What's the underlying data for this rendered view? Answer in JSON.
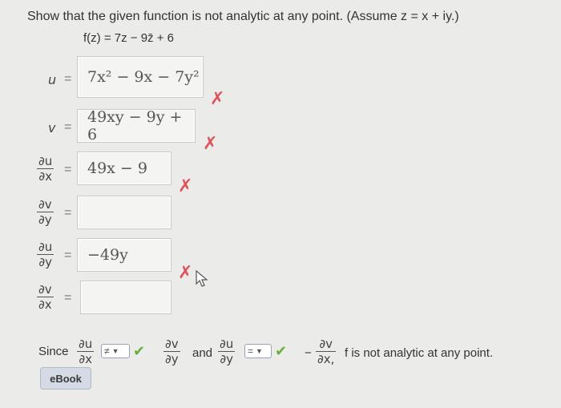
{
  "question": {
    "prompt": "Show that the given function is not analytic at any point. (Assume z = x + iy.)",
    "function": "f(z) = 7z − 9z̄ + 6"
  },
  "rows": [
    {
      "label": "u",
      "answer": "7x² − 9x − 7y²",
      "status": "incorrect"
    },
    {
      "label": "v",
      "answer": "49xy − 9y + 6",
      "status": "incorrect"
    },
    {
      "num": "∂u",
      "den": "∂x",
      "answer": "49x − 9",
      "status": "incorrect"
    },
    {
      "num": "∂v",
      "den": "∂y",
      "answer": "",
      "status": ""
    },
    {
      "num": "∂u",
      "den": "∂y",
      "answer": "−49y",
      "status": "incorrect"
    },
    {
      "num": "∂v",
      "den": "∂x",
      "answer": "",
      "status": ""
    }
  ],
  "conclusion": {
    "since": "Since",
    "d1_num": "∂u",
    "d1_den": "∂x",
    "select1": "≠",
    "d2_num": "∂v",
    "d2_den": "∂y",
    "and": "and",
    "d3_num": "∂u",
    "d3_den": "∂y",
    "select2": "=",
    "minus": "−",
    "d4_num": "∂v",
    "d4_den": "∂x,",
    "tail": "f is not analytic at any point."
  },
  "equals": "=",
  "mark_incorrect": "✗",
  "mark_correct": "✔",
  "ebook_label": "eBook",
  "colors": {
    "incorrect": "#e0525a",
    "correct": "#6aae3d"
  }
}
